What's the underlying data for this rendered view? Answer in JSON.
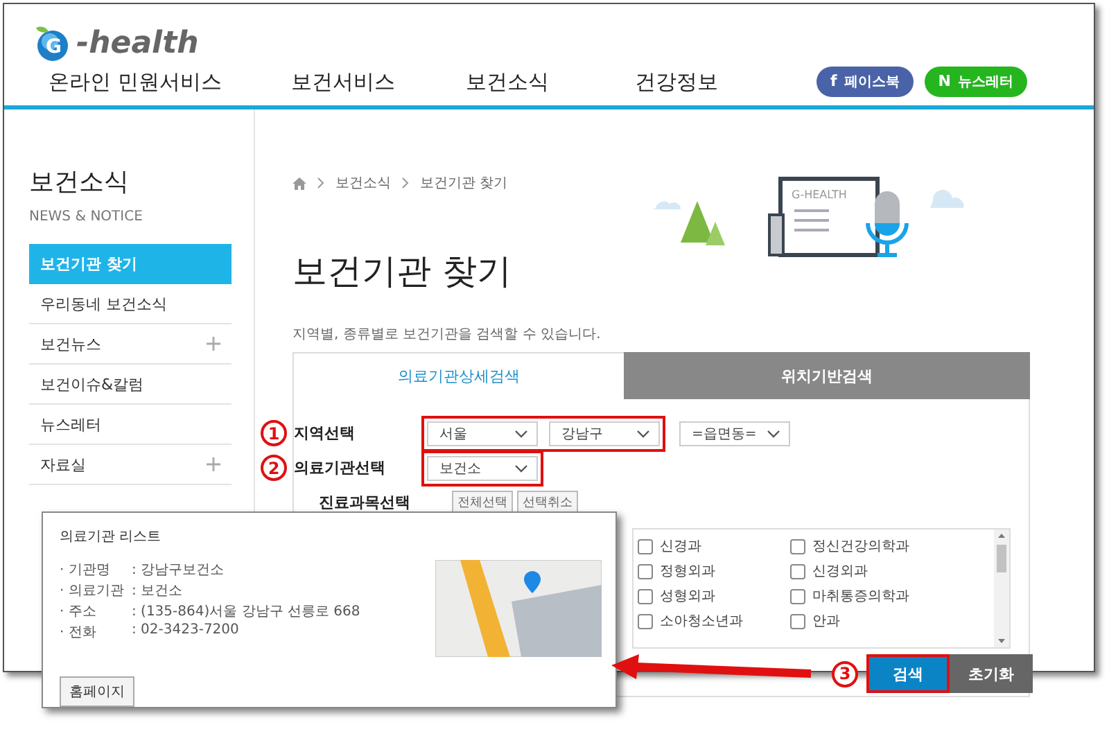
{
  "logo": {
    "mark": "G",
    "text": "-health"
  },
  "nav": [
    {
      "label": "온라인 민원서비스"
    },
    {
      "label": "보건서비스"
    },
    {
      "label": "보건소식"
    },
    {
      "label": "건강정보"
    }
  ],
  "social_buttons": [
    {
      "kind": "facebook",
      "glyph": "f",
      "label": "페이스북"
    },
    {
      "kind": "newsletter",
      "glyph": "N",
      "label": "뉴스레터"
    }
  ],
  "sidebar": {
    "title": "보건소식",
    "subtitle": "NEWS & NOTICE",
    "items": [
      {
        "label": "보건기관 찾기",
        "selected": true,
        "expandable": false
      },
      {
        "label": "우리동네 보건소식",
        "selected": false,
        "expandable": false
      },
      {
        "label": "보건뉴스",
        "selected": false,
        "expandable": true
      },
      {
        "label": "보건이슈&칼럼",
        "selected": false,
        "expandable": false
      },
      {
        "label": "뉴스레터",
        "selected": false,
        "expandable": false
      },
      {
        "label": "자료실",
        "selected": false,
        "expandable": true
      }
    ]
  },
  "breadcrumb": [
    "보건소식",
    "보건기관 찾기"
  ],
  "illustration": {
    "text": "G-HEALTH"
  },
  "page_title": "보건기관 찾기",
  "description": "지역별, 종류별로 보건기관을 검색할 수 있습니다.",
  "tabs": [
    {
      "label": "의료기관상세검색",
      "selected": true
    },
    {
      "label": "위치기반검색",
      "selected": false
    }
  ],
  "form": {
    "region": {
      "marker": "1",
      "label": "지역선택",
      "annotated": true,
      "selects": [
        "서울",
        "강남구",
        "=읍면동="
      ]
    },
    "institution": {
      "marker": "2",
      "label": "의료기관선택",
      "annotated": true,
      "selects": [
        "보건소"
      ]
    },
    "department": {
      "label": "진료과목선택",
      "buttons": [
        "전체선택",
        "선택취소"
      ],
      "options": [
        {
          "label": "신경과",
          "checked": false
        },
        {
          "label": "정신건강의학과",
          "checked": false
        },
        {
          "label": "정형외과",
          "checked": false
        },
        {
          "label": "신경외과",
          "checked": false
        },
        {
          "label": "성형외과",
          "checked": false
        },
        {
          "label": "마취통증의학과",
          "checked": false
        },
        {
          "label": "소아청소년과",
          "checked": false
        },
        {
          "label": "안과",
          "checked": false
        }
      ]
    },
    "actions": {
      "marker": "3",
      "search": "검색",
      "search_annotated": true,
      "reset": "초기화"
    }
  },
  "popup": {
    "title": "의료기관 리스트",
    "fields": [
      {
        "label": "· 기관명",
        "value": ": 강남구보건소"
      },
      {
        "label": "· 의료기관",
        "value": ": 보건소"
      },
      {
        "label": "· 주소",
        "value": ": (135-864)서울 강남구 선릉로 668"
      },
      {
        "label": "· 전화",
        "value": ": 02-3423-7200"
      }
    ],
    "button": "홈페이지"
  }
}
